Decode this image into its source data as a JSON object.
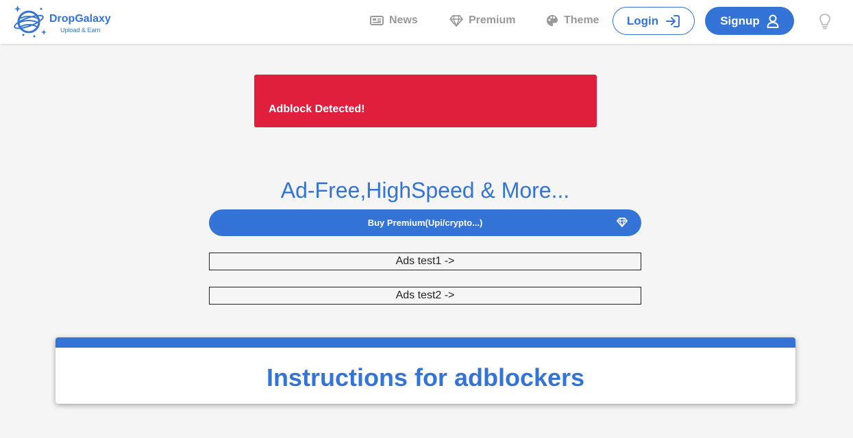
{
  "brand": {
    "name": "DropGalaxy",
    "tagline": "Upload & Earn",
    "primary_color": "#3374d6",
    "alert_color": "#e01f3d"
  },
  "nav": {
    "news": {
      "label": "News",
      "icon": "newspaper-icon"
    },
    "premium": {
      "label": "Premium",
      "icon": "diamond-icon"
    },
    "theme": {
      "label": "Theme",
      "icon": "palette-icon"
    },
    "login": {
      "label": "Login",
      "icon": "sign-in-icon"
    },
    "signup": {
      "label": "Signup",
      "icon": "user-icon"
    },
    "toggle": {
      "icon": "lightbulb-icon"
    }
  },
  "alert": {
    "message": "Adblock Detected!"
  },
  "premium": {
    "headline": "Ad-Free,HighSpeed & More...",
    "buy_label": "Buy Premium(Upi/crypto...)",
    "buy_icon": "diamond-icon"
  },
  "ads": [
    {
      "label": "Ads test1 ->"
    },
    {
      "label": "Ads test2 ->"
    }
  ],
  "instructions": {
    "title": "Instructions for adblockers"
  }
}
